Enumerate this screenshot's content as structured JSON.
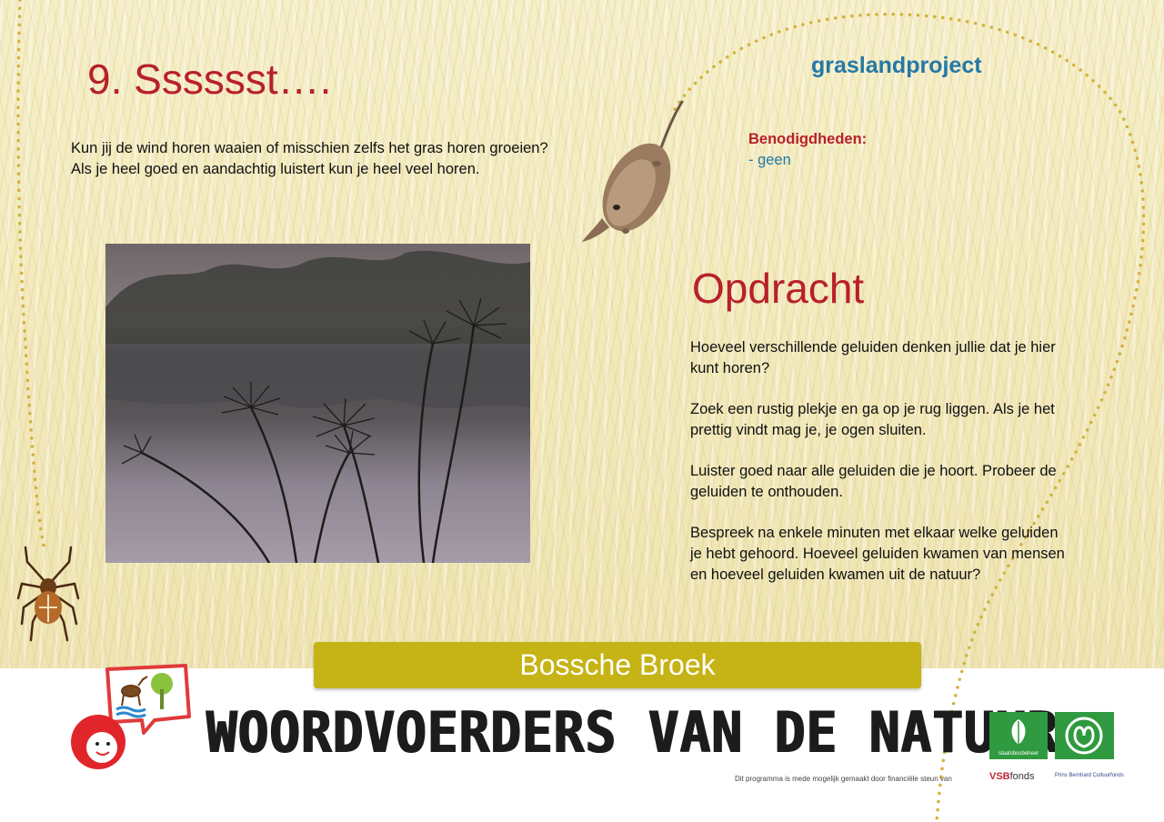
{
  "header": {
    "title": "9. Sssssst….",
    "project": "graslandproject"
  },
  "intro": "Kun jij de wind horen waaien of misschien zelfs het gras horen groeien? Als je heel goed en aandachtig luistert kun je heel veel horen.",
  "supplies": {
    "label": "Benodigdheden:",
    "items": [
      "- geen"
    ]
  },
  "assignment": {
    "heading": "Opdracht",
    "paragraphs": [
      "Hoeveel verschillende geluiden denken jullie dat je hier kunt horen?",
      "Zoek een rustig plekje en ga op je rug liggen. Als je het prettig vindt mag je, je ogen sluiten.",
      "Luister goed naar alle geluiden die je hoort. Probeer de geluiden te onthouden.",
      "Bespreek na enkele minuten met elkaar welke geluiden je hebt gehoord. Hoeveel geluiden kwamen van mensen en hoeveel geluiden kwamen uit de natuur?"
    ]
  },
  "location_banner": "Bossche Broek",
  "footer": {
    "wordmark": "WOORDVOERDERS VAN DE NATUUR",
    "funding_note": "Dit programma is mede mogelijk gemaakt door financiële steun van",
    "sponsor_vsb": "VSB",
    "sponsor_vsb_suffix": "fonds",
    "sponsor_staatsbosbeheer": "staatsbosbeheer",
    "sponsor_pbc": "Prins Bernhard Cultuurfonds"
  },
  "colors": {
    "accent_red": "#b8202b",
    "accent_blue": "#2378a8",
    "banner": "#c6b315",
    "sponsor_green": "#2f9a3f"
  },
  "icons": [
    "shrew-illustration",
    "spider-icon",
    "deer-icon",
    "tree-icon",
    "child-face-icon",
    "staatsbosbeheer-logo",
    "natuurmonumenten-logo"
  ]
}
